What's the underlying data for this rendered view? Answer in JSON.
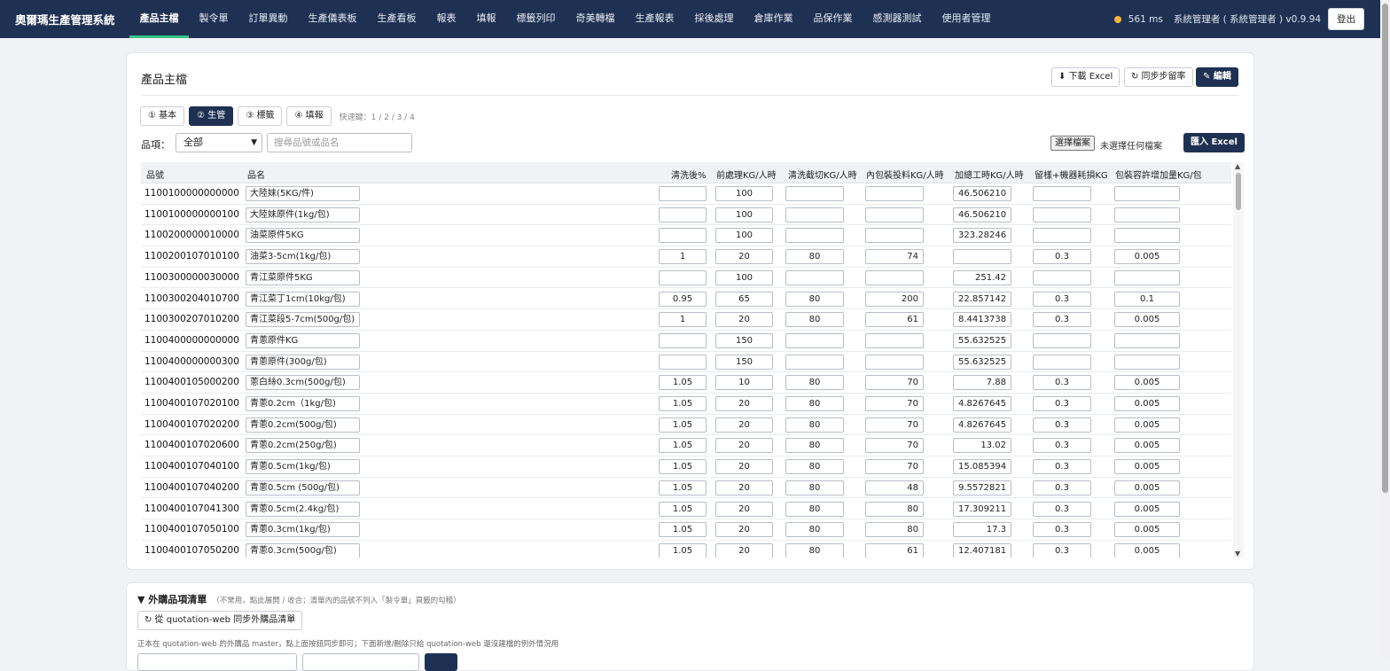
{
  "app": {
    "title": "奧爾瑪生產管理系統"
  },
  "nav": [
    {
      "label": "產品主檔",
      "active": true
    },
    {
      "label": "製令單"
    },
    {
      "label": "訂單異動"
    },
    {
      "label": "生產儀表板"
    },
    {
      "label": "生產看板"
    },
    {
      "label": "報表"
    },
    {
      "label": "填報"
    },
    {
      "label": "標籤列印"
    },
    {
      "label": "奇美轉檔"
    },
    {
      "label": "生產報表"
    },
    {
      "label": "採後處理"
    },
    {
      "label": "倉庫作業"
    },
    {
      "label": "品保作業"
    },
    {
      "label": "感測器測試"
    },
    {
      "label": "使用者管理"
    }
  ],
  "status": {
    "latency": "561 ms",
    "user": "系統管理者 ( 系統管理者 ) v0.9.94",
    "logout": "登出",
    "dot_color": "#f2b63a"
  },
  "page": {
    "title": "產品主檔"
  },
  "toolbar": {
    "download": "⬇ 下載 Excel",
    "sync": "↻ 同步步留率",
    "edit": "✎ 編輯"
  },
  "tabs": [
    {
      "label": "① 基本"
    },
    {
      "label": "② 生管",
      "active": true
    },
    {
      "label": "③ 標籤"
    },
    {
      "label": "④ 填報"
    }
  ],
  "tabs_hint": "快速鍵：1 / 2 / 3 / 4",
  "filter": {
    "label": "品項：",
    "value": "全部",
    "search_placeholder": "搜尋品號或品名"
  },
  "file": {
    "choose": "選擇檔案",
    "none": "未選擇任何檔案",
    "import": "匯入 Excel"
  },
  "table": {
    "headers": [
      "品號",
      "品名",
      "清洗後%",
      "前處理KG/人時",
      "清洗截切KG/人時",
      "內包裝投料KG/人時",
      "加總工時KG/人時",
      "留樣+機器耗損KG",
      "包裝容許增加量KG/包"
    ],
    "rows": [
      [
        "1100100000000000",
        "大陸妹(5KG/件)",
        "",
        "100",
        "",
        "",
        "46.506210",
        "",
        ""
      ],
      [
        "1100100000000100",
        "大陸妹原件(1kg/包)",
        "",
        "100",
        "",
        "",
        "46.506210",
        "",
        ""
      ],
      [
        "1100200000010000",
        "油菜原件5KG",
        "",
        "100",
        "",
        "",
        "323.28246",
        "",
        ""
      ],
      [
        "1100200107010100",
        "油菜3-5cm(1kg/包)",
        "1",
        "20",
        "80",
        "74",
        "",
        "0.3",
        "0.005"
      ],
      [
        "1100300000030000",
        "青江菜原件5KG",
        "",
        "100",
        "",
        "",
        "251.42",
        "",
        ""
      ],
      [
        "1100300204010700",
        "青江菜丁1cm(10kg/包)",
        "0.95",
        "65",
        "80",
        "200",
        "22.857142",
        "0.3",
        "0.1"
      ],
      [
        "1100300207010200",
        "青江菜段5-7cm(500g/包)",
        "1",
        "20",
        "80",
        "61",
        "8.4413738",
        "0.3",
        "0.005"
      ],
      [
        "1100400000000000",
        "青蔥原件KG",
        "",
        "150",
        "",
        "",
        "55.632525",
        "",
        ""
      ],
      [
        "1100400000000300",
        "青蔥原件(300g/包)",
        "",
        "150",
        "",
        "",
        "55.632525",
        "",
        ""
      ],
      [
        "1100400105000200",
        "蔥白絲0.3cm(500g/包)",
        "1.05",
        "10",
        "80",
        "70",
        "7.88",
        "0.3",
        "0.005"
      ],
      [
        "1100400107020100",
        "青蔥0.2cm（1kg/包)",
        "1.05",
        "20",
        "80",
        "70",
        "4.8267645",
        "0.3",
        "0.005"
      ],
      [
        "1100400107020200",
        "青蔥0.2cm(500g/包)",
        "1.05",
        "20",
        "80",
        "70",
        "4.8267645",
        "0.3",
        "0.005"
      ],
      [
        "1100400107020600",
        "青蔥0.2cm(250g/包)",
        "1.05",
        "20",
        "80",
        "70",
        "13.02",
        "0.3",
        "0.005"
      ],
      [
        "1100400107040100",
        "青蔥0.5cm(1kg/包)",
        "1.05",
        "20",
        "80",
        "70",
        "15.085394",
        "0.3",
        "0.005"
      ],
      [
        "1100400107040200",
        "青蔥0.5cm (500g/包)",
        "1.05",
        "20",
        "80",
        "48",
        "9.5572821",
        "0.3",
        "0.005"
      ],
      [
        "1100400107041300",
        "青蔥0.5cm(2.4kg/包)",
        "1.05",
        "20",
        "80",
        "80",
        "17.309211",
        "0.3",
        "0.005"
      ],
      [
        "1100400107050100",
        "青蔥0.3cm(1kg/包)",
        "1.05",
        "20",
        "80",
        "80",
        "17.3",
        "0.3",
        "0.005"
      ],
      [
        "1100400107050200",
        "青蔥0.3cm(500g/包)",
        "1.05",
        "20",
        "80",
        "61",
        "12.407181",
        "0.3",
        "0.005"
      ]
    ]
  },
  "external": {
    "title": "▼  外購品項清單",
    "subtitle": "（不常用，點此展開 / 收合；清單內的品號不列入「製令單」頁籤的勾稽）",
    "sync_button": "↻ 從 quotation-web 同步外購品清單",
    "note": "正本在 quotation-web 的外購品 master，點上面按鈕同步即可；下面新增/刪除只給 quotation-web 還沒建檔的例外情況用"
  }
}
